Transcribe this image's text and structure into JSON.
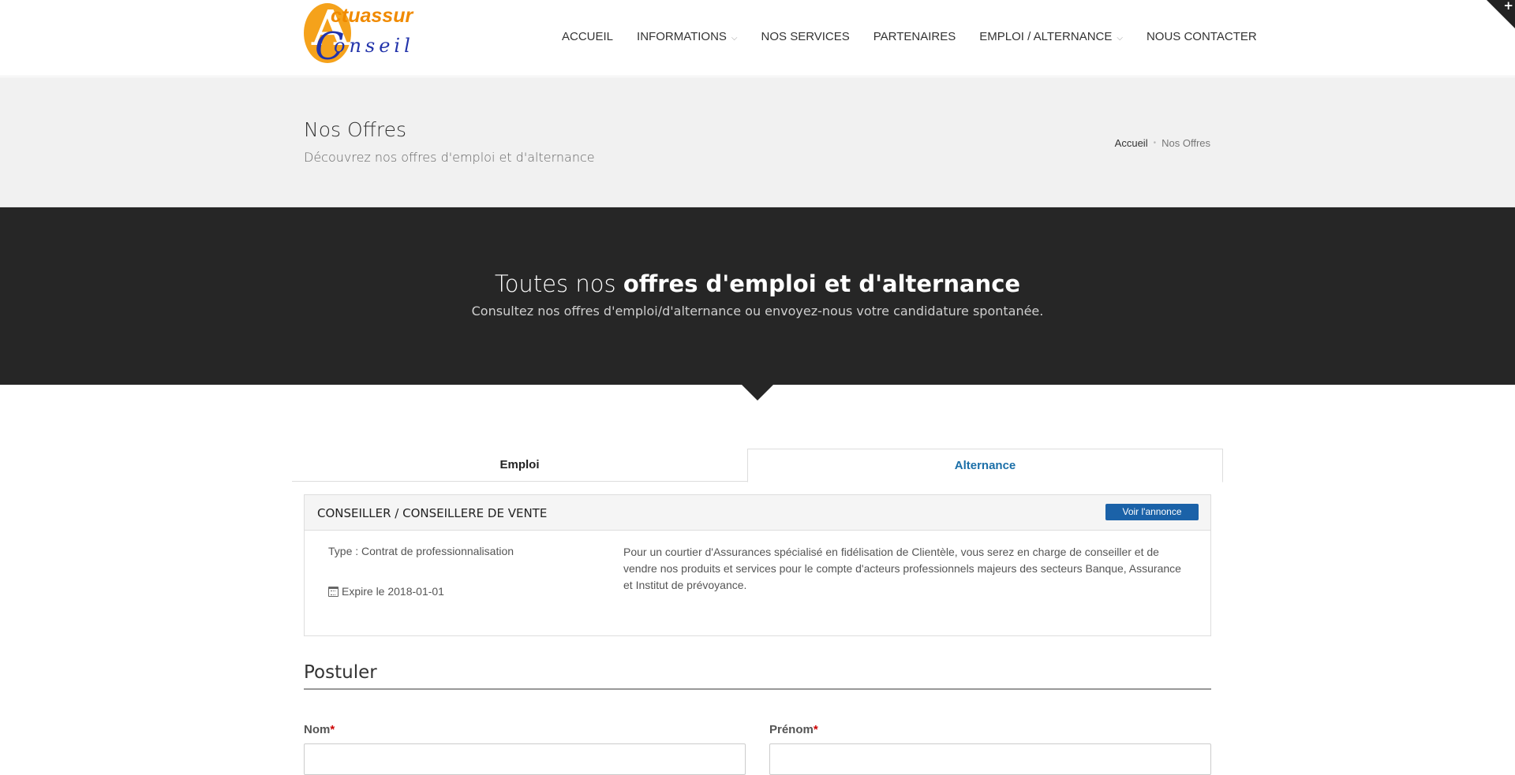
{
  "header": {
    "logo": {
      "top_text": "ctuassur",
      "bottom_text": "onseil",
      "initial_a": "A",
      "initial_c": "C"
    },
    "nav": [
      {
        "label": "ACCUEIL",
        "dropdown": false
      },
      {
        "label": "INFORMATIONS",
        "dropdown": true
      },
      {
        "label": "NOS SERVICES",
        "dropdown": false
      },
      {
        "label": "PARTENAIRES",
        "dropdown": false
      },
      {
        "label": "EMPLOI / ALTERNANCE",
        "dropdown": true
      },
      {
        "label": "NOUS CONTACTER",
        "dropdown": false
      }
    ],
    "corner_symbol": "+"
  },
  "title_band": {
    "title": "Nos Offres",
    "subtitle": "Découvrez nos offres d'emploi et d'alternance",
    "breadcrumb": {
      "home": "Accueil",
      "separator": "•",
      "current": "Nos Offres"
    }
  },
  "hero": {
    "title_normal": "Toutes nos ",
    "title_bold": "offres d'emploi et d'alternance",
    "subtitle": "Consultez nos offres d'emploi/d'alternance ou envoyez-nous votre candidature spontanée."
  },
  "tabs": [
    {
      "label": "Emploi",
      "active": false
    },
    {
      "label": "Alternance",
      "active": true
    }
  ],
  "job": {
    "title": "CONSEILLER / CONSEILLERE DE VENTE",
    "button_label": "Voir l'annonce",
    "type": "Type : Contrat de professionnalisation",
    "expire": "Expire le 2018-01-01",
    "description": "Pour un courtier d'Assurances spécialisé en fidélisation de Clientèle, vous serez en charge de conseiller et de vendre nos produits et services pour le compte d'acteurs professionnels majeurs des secteurs Banque, Assurance et Institut de prévoyance."
  },
  "form": {
    "title": "Postuler",
    "nom_label": "Nom",
    "prenom_label": "Prénom",
    "required_mark": "*",
    "nom_value": "",
    "prenom_value": ""
  },
  "colors": {
    "accent": "#1b6fa8",
    "button": "#1b62a8",
    "hero_bg": "#262626",
    "logo_orange": "#f5a21b",
    "logo_blue": "#2233aa"
  }
}
